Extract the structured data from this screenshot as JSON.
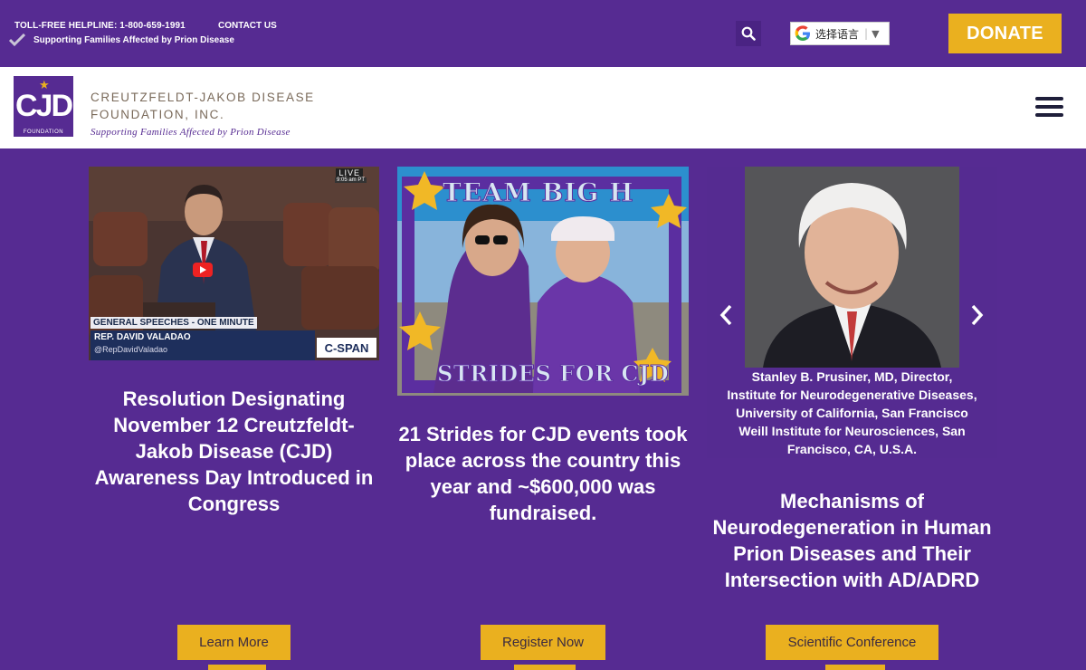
{
  "topbar": {
    "helpline": "TOLL-FREE HELPLINE: 1-800-659-1991",
    "contact": "CONTACT US",
    "tagline": "Supporting Families Affected by Prion Disease",
    "language_label": "选择语言",
    "language_arrow": "▼",
    "donate": "DONATE"
  },
  "header": {
    "logo_text": "CJD",
    "logo_sub": "FOUNDATION",
    "org_line1": "CREUTZFELDT-JAKOB DISEASE",
    "org_line2": "FOUNDATION, INC.",
    "org_tagline": "Supporting Families Affected by Prion Disease"
  },
  "cards": [
    {
      "title": "Resolution Designating November 12 Creutzfeldt-Jakob Disease (CJD) Awareness Day Introduced in Congress",
      "button": "Learn More",
      "video": {
        "live": "LIVE",
        "time": "9:05 am PT",
        "banner": "GENERAL SPEECHES - ONE MINUTE",
        "name": "REP. DAVID VALADAO",
        "handle": "@RepDavidValadao",
        "network": "C-SPAN"
      }
    },
    {
      "title": "21 Strides for CJD events took place across the country this year and ~$600,000 was fundraised.",
      "button": "Register Now",
      "photo": {
        "frame_top": "TEAM BIG H",
        "frame_bottom": "STRIDES FOR CJD"
      }
    },
    {
      "title": "Mechanisms of Neurodegeneration in Human Prion Diseases and Their Intersection with AD/ADRD",
      "button": "Scientific Conference",
      "caption_lines": [
        "Stanley B. Prusiner, MD, Director,",
        "Institute for Neurodegenerative Diseases,",
        "University of California, San Francisco",
        "Weill Institute for Neurosciences, San",
        "Francisco, CA, U.S.A."
      ]
    }
  ],
  "colors": {
    "brand_purple": "#562b92",
    "accent_gold": "#eab01f"
  }
}
